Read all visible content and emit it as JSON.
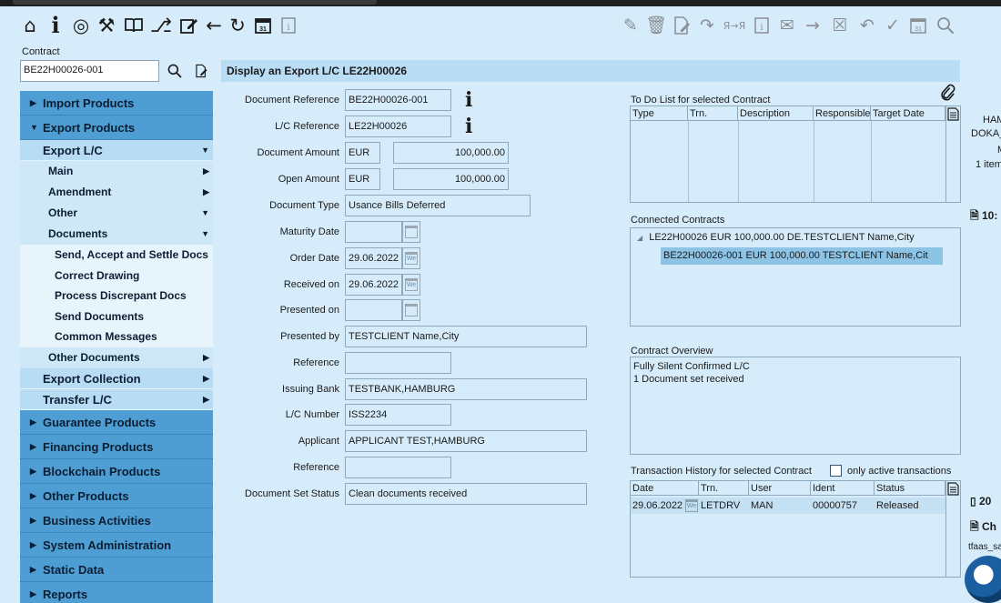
{
  "toolbar": {
    "left_icons": [
      "home-icon",
      "info-icon",
      "target-icon",
      "tools-icon",
      "book-icon",
      "routing-icon",
      "edit-icon",
      "back-arrow-icon",
      "refresh-icon",
      "calendar-icon",
      "info-box-icon"
    ],
    "right_icons": [
      "edit-doc-icon",
      "trash-icon",
      "doc-edit-icon",
      "redo-icon",
      "translate-icon",
      "info-box-icon",
      "mail-icon",
      "forward-arrow-icon",
      "close-box-icon",
      "undo-icon",
      "check-icon",
      "calendar-icon",
      "search-icon"
    ]
  },
  "contract": {
    "label": "Contract",
    "value": "BE22H00026-001"
  },
  "sidebar": {
    "import_products": "Import Products",
    "export_products": "Export Products",
    "export_lc": "Export L/C",
    "main": "Main",
    "amendment": "Amendment",
    "other": "Other",
    "documents": "Documents",
    "doc_items": [
      "Send, Accept and Settle Docs",
      "Correct Drawing",
      "Process Discrepant Docs",
      "Send Documents",
      "Common Messages"
    ],
    "other_documents": "Other Documents",
    "export_collection": "Export Collection",
    "transfer_lc": "Transfer L/C",
    "guarantee_products": "Guarantee Products",
    "financing_products": "Financing Products",
    "blockchain_products": "Blockchain Products",
    "other_products": "Other Products",
    "business_activities": "Business Activities",
    "system_administration": "System Administration",
    "static_data": "Static Data",
    "reports": "Reports"
  },
  "header": {
    "title": "Display an Export L/C LE22H00026"
  },
  "form": {
    "document_reference": {
      "label": "Document Reference",
      "value": "BE22H00026-001"
    },
    "lc_reference": {
      "label": "L/C Reference",
      "value": "LE22H00026"
    },
    "document_amount": {
      "label": "Document Amount",
      "currency": "EUR",
      "value": "100,000.00"
    },
    "open_amount": {
      "label": "Open Amount",
      "currency": "EUR",
      "value": "100,000.00"
    },
    "document_type": {
      "label": "Document Type",
      "value": "Usance Bills Deferred"
    },
    "maturity_date": {
      "label": "Maturity Date",
      "value": ""
    },
    "order_date": {
      "label": "Order Date",
      "value": "29.06.2022"
    },
    "received_on": {
      "label": "Received on",
      "value": "29.06.2022"
    },
    "presented_on": {
      "label": "Presented on",
      "value": ""
    },
    "presented_by": {
      "label": "Presented by",
      "value": "TESTCLIENT Name,City"
    },
    "reference_1": {
      "label": "Reference",
      "value": ""
    },
    "issuing_bank": {
      "label": "Issuing Bank",
      "value": "TESTBANK,HAMBURG"
    },
    "lc_number": {
      "label": "L/C Number",
      "value": "ISS2234"
    },
    "applicant": {
      "label": "Applicant",
      "value": "APPLICANT TEST,HAMBURG"
    },
    "reference_2": {
      "label": "Reference",
      "value": ""
    },
    "document_set_status": {
      "label": "Document Set Status",
      "value": "Clean documents received"
    }
  },
  "todo": {
    "title": "To Do List for selected Contract",
    "columns": [
      "Type",
      "Trn.",
      "Description",
      "Responsible",
      "Target Date"
    ]
  },
  "connected": {
    "title": "Connected Contracts",
    "parent": "LE22H00026 EUR 100,000.00 DE.TESTCLIENT Name,City",
    "child": "BE22H00026-001 EUR 100,000.00 TESTCLIENT Name,Cit"
  },
  "overview": {
    "title": "Contract Overview",
    "lines": [
      "Fully Silent Confirmed L/C",
      "1 Document set received"
    ]
  },
  "history": {
    "title": "Transaction History for selected Contract",
    "only_active_label": "only active transactions",
    "columns": [
      "Date",
      "Trn.",
      "User",
      "Ident",
      "Status"
    ],
    "rows": [
      {
        "date": "29.06.2022",
        "trn": "LETDRV",
        "user": "MAN",
        "ident": "00000757",
        "status": "Released"
      }
    ]
  },
  "right_panel": {
    "line1": "HAM",
    "line2": "DOKA_",
    "line3": "M",
    "line4": "1 item",
    "badge_a": "10:",
    "badge_b": "20",
    "badge_c": "Ch",
    "user": "tfaas_sa"
  }
}
